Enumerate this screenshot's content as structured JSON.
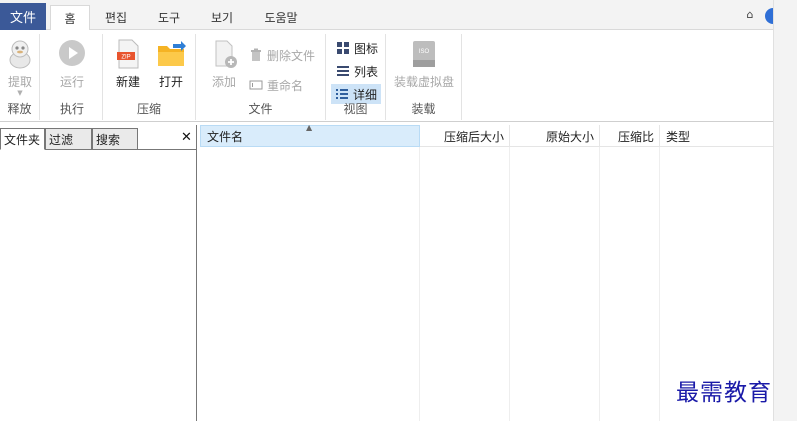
{
  "menu": {
    "file_label": "文件",
    "tabs": [
      "홈",
      "편집",
      "도구",
      "보기",
      "도움말"
    ],
    "active_tab": 0,
    "collapse_icon": "chevron-up-icon",
    "help_color": "#2f6fd6"
  },
  "ribbon": {
    "release": {
      "extract_label": "提取",
      "group_label": "释放"
    },
    "execute": {
      "run_label": "运行",
      "group_label": "执行"
    },
    "compress": {
      "new_label": "新建",
      "open_label": "打开",
      "group_label": "压缩"
    },
    "files": {
      "add_label": "添加",
      "delete_label": "删除文件",
      "rename_label": "重命名",
      "group_label": "文件"
    },
    "view": {
      "icons_label": "图标",
      "list_label": "列表",
      "details_label": "详细",
      "group_label": "视图",
      "selected": "详细"
    },
    "mount": {
      "mount_label": "装载虚拟盘",
      "group_label": "装载"
    }
  },
  "left_panel": {
    "tabs": [
      "文件夹",
      "过滤",
      "搜索"
    ],
    "active_tab": 0,
    "close_label": "✕"
  },
  "file_list": {
    "columns": [
      "文件名",
      "压缩后大小",
      "原始大小",
      "压缩比",
      "类型"
    ],
    "sorted_column": "文件名",
    "rows": []
  },
  "watermark": {
    "text": "最需教育"
  },
  "colors": {
    "file_tab": "#3b5998",
    "selected": "#cde3f7",
    "watermark": "#1a1aa8"
  }
}
